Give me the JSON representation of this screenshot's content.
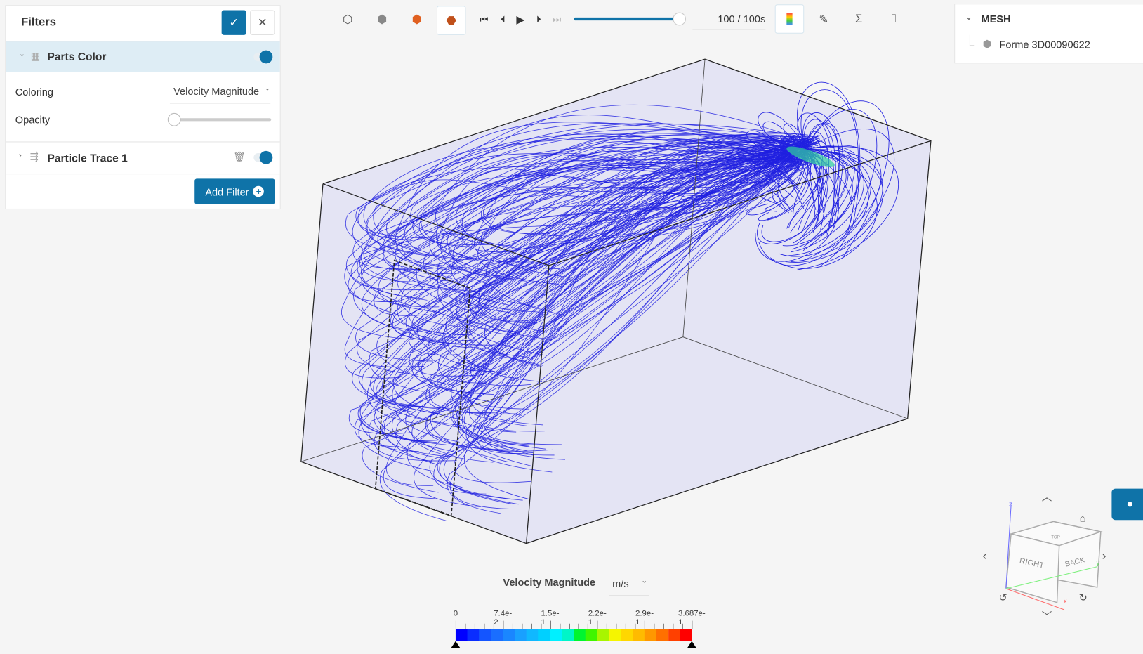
{
  "filters": {
    "title": "Filters",
    "confirm_icon": "check-icon",
    "close_icon": "close-icon",
    "items": [
      {
        "label": "Parts Color",
        "expanded": true,
        "enabled": true,
        "coloring_label": "Coloring",
        "coloring_value": "Velocity Magnitude",
        "opacity_label": "Opacity",
        "opacity_value": 0
      },
      {
        "label": "Particle Trace 1",
        "expanded": false,
        "enabled": true
      }
    ],
    "add_filter": "Add Filter"
  },
  "toolbar": {
    "time_value": "100 / 100s",
    "progress": 1.0
  },
  "tree": {
    "root": "MESH",
    "children": [
      "Forme 3D00090622"
    ]
  },
  "legend": {
    "title": "Velocity Magnitude",
    "unit": "m/s",
    "ticks": [
      "0",
      "7.4e-2",
      "1.5e-1",
      "2.2e-1",
      "2.9e-1",
      "3.687e-1"
    ],
    "min": 0,
    "max": 0.3687,
    "colors": [
      "#0000ff",
      "#0a2dff",
      "#1455ff",
      "#1a6eff",
      "#1a86ff",
      "#19a0ff",
      "#10b8ff",
      "#00d0ff",
      "#00f0ff",
      "#00f5c8",
      "#00f530",
      "#40f500",
      "#a8f500",
      "#f5f500",
      "#ffd700",
      "#ffbb00",
      "#ff9800",
      "#ff7000",
      "#ff4000",
      "#ff0000"
    ]
  },
  "viewcube": {
    "faces": [
      "RIGHT",
      "BACK",
      "TOP"
    ],
    "axes": [
      "x",
      "y",
      "z"
    ]
  },
  "colors": {
    "accent": "#0f73a8",
    "streamline": "#2020e0",
    "box_fill": "#e6e6f5"
  }
}
